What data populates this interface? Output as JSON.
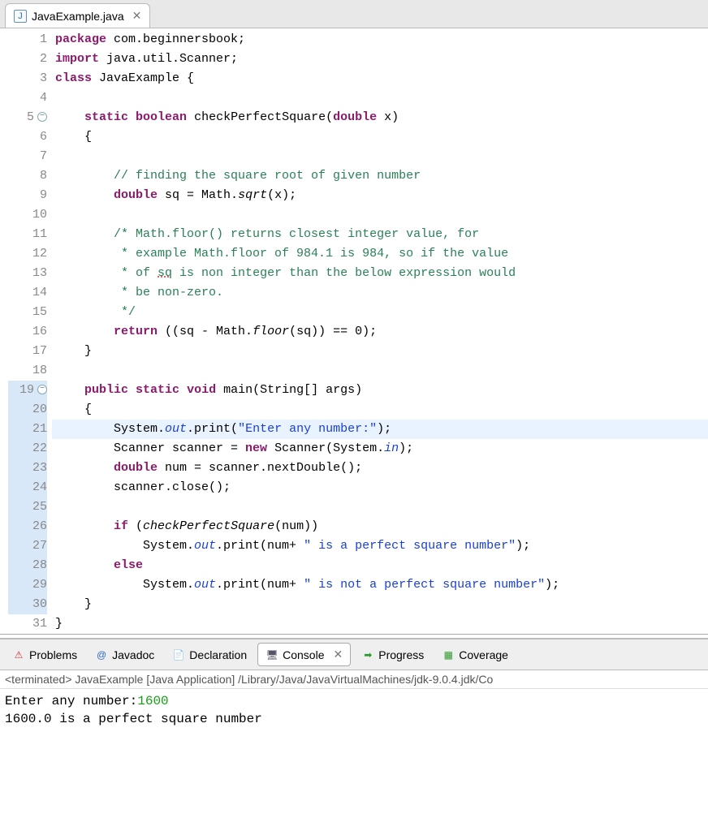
{
  "file_tab": {
    "icon_letter": "J",
    "name": "JavaExample.java",
    "close_glyph": "✕"
  },
  "code": {
    "line_count": 31,
    "fold_lines": [
      5,
      19
    ],
    "blue_lines": [
      19,
      20,
      21,
      22,
      23,
      24,
      25,
      26,
      27,
      28,
      29,
      30
    ],
    "highlight_line": 21,
    "lines": {
      "1": [
        {
          "cls": "kw",
          "t": "package"
        },
        {
          "t": " com.beginnersbook;"
        }
      ],
      "2": [
        {
          "cls": "kw",
          "t": "import"
        },
        {
          "t": " java.util.Scanner;"
        }
      ],
      "3": [
        {
          "cls": "kw",
          "t": "class"
        },
        {
          "t": " JavaExample {"
        }
      ],
      "4": [
        {
          "t": ""
        }
      ],
      "5": [
        {
          "t": "    "
        },
        {
          "cls": "kw",
          "t": "static"
        },
        {
          "t": " "
        },
        {
          "cls": "kw",
          "t": "boolean"
        },
        {
          "t": " checkPerfectSquare("
        },
        {
          "cls": "kw",
          "t": "double"
        },
        {
          "t": " x)"
        }
      ],
      "6": [
        {
          "t": "    {"
        }
      ],
      "7": [
        {
          "t": ""
        }
      ],
      "8": [
        {
          "t": "        "
        },
        {
          "cls": "cmt",
          "t": "// finding the square root of given number"
        }
      ],
      "9": [
        {
          "t": "        "
        },
        {
          "cls": "kw",
          "t": "double"
        },
        {
          "t": " sq = Math."
        },
        {
          "cls": "methit",
          "t": "sqrt"
        },
        {
          "t": "(x);"
        }
      ],
      "10": [
        {
          "t": ""
        }
      ],
      "11": [
        {
          "t": "        "
        },
        {
          "cls": "cmt",
          "t": "/* Math.floor() returns closest integer value, for"
        }
      ],
      "12": [
        {
          "t": "        "
        },
        {
          "cls": "cmt",
          "t": " * example Math.floor of 984.1 is 984, so if the value"
        }
      ],
      "13": [
        {
          "t": "        "
        },
        {
          "cls": "cmt",
          "t": " * of "
        },
        {
          "cls": "cmt spellerr",
          "t": "sq"
        },
        {
          "cls": "cmt",
          "t": " is non integer than the below expression would"
        }
      ],
      "14": [
        {
          "t": "        "
        },
        {
          "cls": "cmt",
          "t": " * be non-zero."
        }
      ],
      "15": [
        {
          "t": "        "
        },
        {
          "cls": "cmt",
          "t": " */"
        }
      ],
      "16": [
        {
          "t": "        "
        },
        {
          "cls": "kw",
          "t": "return"
        },
        {
          "t": " ((sq - Math."
        },
        {
          "cls": "methit",
          "t": "floor"
        },
        {
          "t": "(sq)) == 0);"
        }
      ],
      "17": [
        {
          "t": "    }"
        }
      ],
      "18": [
        {
          "t": ""
        }
      ],
      "19": [
        {
          "t": "    "
        },
        {
          "cls": "kw",
          "t": "public"
        },
        {
          "t": " "
        },
        {
          "cls": "kw",
          "t": "static"
        },
        {
          "t": " "
        },
        {
          "cls": "kw",
          "t": "void"
        },
        {
          "t": " main(String[] args)"
        }
      ],
      "20": [
        {
          "t": "    {"
        }
      ],
      "21": [
        {
          "t": "        System."
        },
        {
          "cls": "static-it",
          "t": "out"
        },
        {
          "t": ".print("
        },
        {
          "cls": "str",
          "t": "\"Enter any number:\""
        },
        {
          "t": ");"
        }
      ],
      "22": [
        {
          "t": "        Scanner scanner = "
        },
        {
          "cls": "kw",
          "t": "new"
        },
        {
          "t": " Scanner(System."
        },
        {
          "cls": "static-it",
          "t": "in"
        },
        {
          "t": ");"
        }
      ],
      "23": [
        {
          "t": "        "
        },
        {
          "cls": "kw",
          "t": "double"
        },
        {
          "t": " num = scanner.nextDouble();"
        }
      ],
      "24": [
        {
          "t": "        scanner.close();"
        }
      ],
      "25": [
        {
          "t": ""
        }
      ],
      "26": [
        {
          "t": "        "
        },
        {
          "cls": "kw",
          "t": "if"
        },
        {
          "t": " ("
        },
        {
          "cls": "methit",
          "t": "checkPerfectSquare"
        },
        {
          "t": "(num))"
        }
      ],
      "27": [
        {
          "t": "            System."
        },
        {
          "cls": "static-it",
          "t": "out"
        },
        {
          "t": ".print(num+ "
        },
        {
          "cls": "str",
          "t": "\" is a perfect square number\""
        },
        {
          "t": ");"
        }
      ],
      "28": [
        {
          "t": "        "
        },
        {
          "cls": "kw",
          "t": "else"
        }
      ],
      "29": [
        {
          "t": "            System."
        },
        {
          "cls": "static-it",
          "t": "out"
        },
        {
          "t": ".print(num+ "
        },
        {
          "cls": "str",
          "t": "\" is not a perfect square number\""
        },
        {
          "t": ");"
        }
      ],
      "30": [
        {
          "t": "    }"
        }
      ],
      "31": [
        {
          "t": "}"
        }
      ]
    }
  },
  "bottom_tabs": [
    {
      "icon": "⚠",
      "icon_color": "#c33",
      "label": "Problems",
      "active": false
    },
    {
      "icon": "@",
      "icon_color": "#2a67c9",
      "label": "Javadoc",
      "active": false
    },
    {
      "icon": "📄",
      "icon_color": "#c9a227",
      "label": "Declaration",
      "active": false
    },
    {
      "icon": "🖥",
      "icon_color": "#556",
      "label": "Console",
      "active": true,
      "close": "✕"
    },
    {
      "icon": "➡",
      "icon_color": "#2a9a2a",
      "label": "Progress",
      "active": false
    },
    {
      "icon": "▦",
      "icon_color": "#2a9a2a",
      "label": "Coverage",
      "active": false
    }
  ],
  "console": {
    "status": "<terminated> JavaExample [Java Application] /Library/Java/JavaVirtualMachines/jdk-9.0.4.jdk/Co",
    "out_prefix": "Enter any number:",
    "out_input": "1600",
    "out_line2": "1600.0 is a perfect square number"
  }
}
